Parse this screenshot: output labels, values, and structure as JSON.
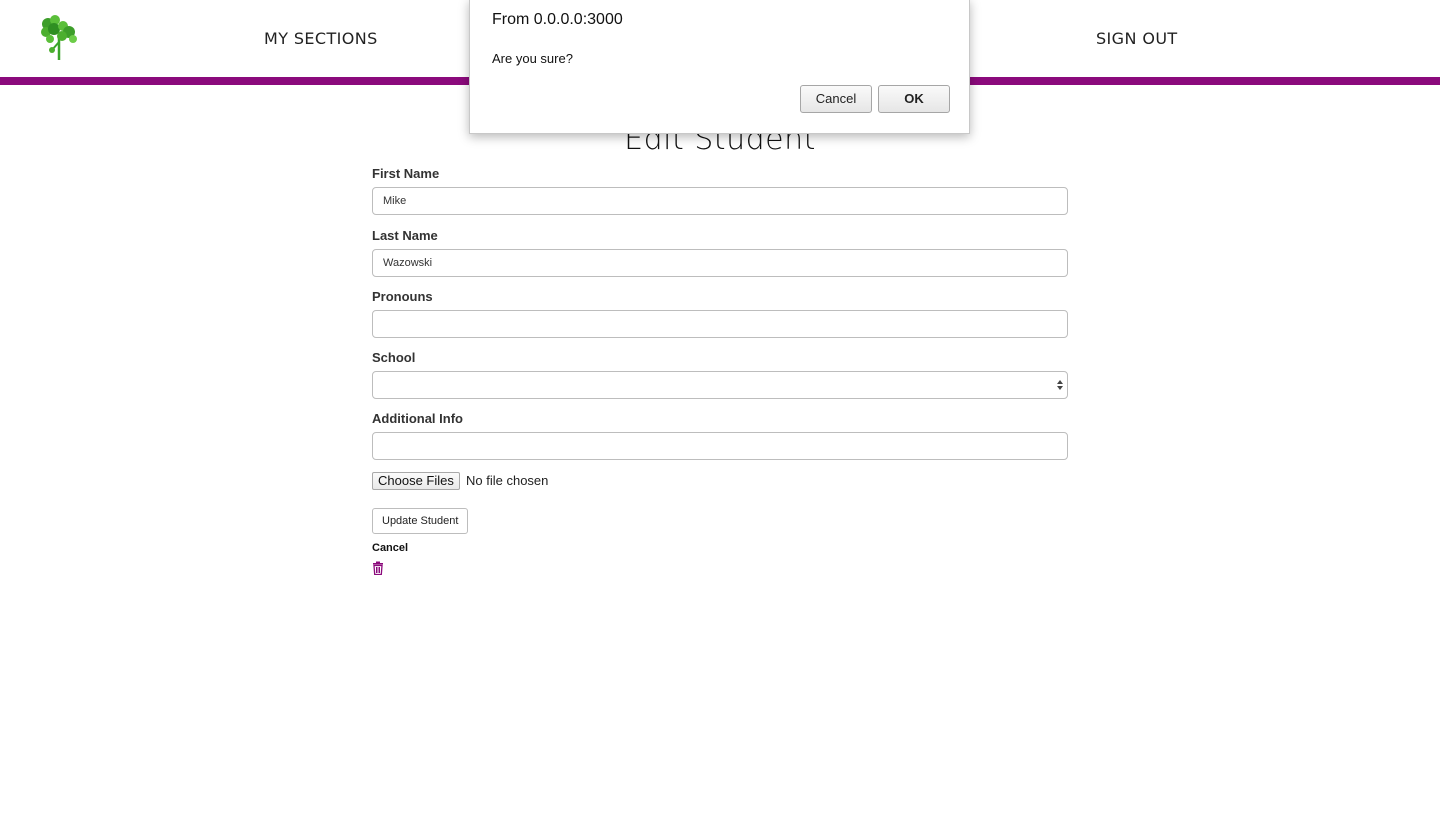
{
  "colors": {
    "accent": "#8b0a7c",
    "logo_green": "#4caf2f"
  },
  "header": {
    "logo_icon": "parsley-leaf-icon",
    "nav": {
      "my_sections": "MY SECTIONS",
      "sign_out": "SIGN OUT"
    }
  },
  "form": {
    "title": "Edit Student",
    "fields": {
      "first_name": {
        "label": "First Name",
        "value": "Mike"
      },
      "last_name": {
        "label": "Last Name",
        "value": "Wazowski"
      },
      "pronouns": {
        "label": "Pronouns",
        "value": ""
      },
      "school": {
        "label": "School",
        "value": ""
      },
      "additional_info": {
        "label": "Additional Info",
        "value": ""
      }
    },
    "file_upload": {
      "button_label": "Choose Files",
      "status": "No file chosen"
    },
    "submit_label": "Update Student",
    "cancel_label": "Cancel",
    "delete_icon": "trash-icon"
  },
  "dialog": {
    "title": "From 0.0.0.0:3000",
    "message": "Are you sure?",
    "cancel_label": "Cancel",
    "ok_label": "OK"
  }
}
